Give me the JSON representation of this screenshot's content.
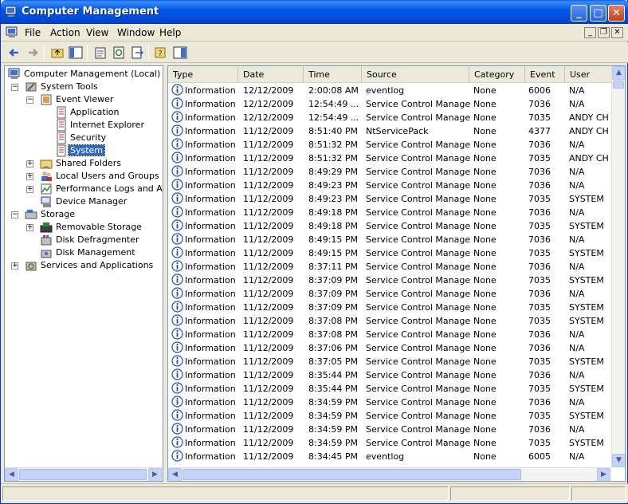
{
  "window": {
    "title": "Computer Management"
  },
  "menu": [
    "File",
    "Action",
    "View",
    "Window",
    "Help"
  ],
  "toolbar": {
    "icons": [
      "back-icon",
      "forward-icon",
      "up-folder-icon",
      "show-hide-tree-icon",
      "properties-icon",
      "refresh-icon",
      "export-list-icon",
      "help-icon",
      "action-pane-icon"
    ]
  },
  "tree": {
    "root": "Computer Management (Local)",
    "items": [
      {
        "label": "System Tools"
      },
      {
        "label": "Event Viewer"
      },
      {
        "label": "Application"
      },
      {
        "label": "Internet Explorer"
      },
      {
        "label": "Security"
      },
      {
        "label": "System"
      },
      {
        "label": "Shared Folders"
      },
      {
        "label": "Local Users and Groups"
      },
      {
        "label": "Performance Logs and Alerts"
      },
      {
        "label": "Device Manager"
      },
      {
        "label": "Storage"
      },
      {
        "label": "Removable Storage"
      },
      {
        "label": "Disk Defragmenter"
      },
      {
        "label": "Disk Management"
      },
      {
        "label": "Services and Applications"
      }
    ]
  },
  "columns": [
    "Type",
    "Date",
    "Time",
    "Source",
    "Category",
    "Event",
    "User"
  ],
  "rows": [
    [
      "Information",
      "12/12/2009",
      "2:00:08 AM",
      "eventlog",
      "None",
      "6006",
      "N/A"
    ],
    [
      "Information",
      "12/12/2009",
      "12:54:49 ...",
      "Service Control Manager",
      "None",
      "7036",
      "N/A"
    ],
    [
      "Information",
      "12/12/2009",
      "12:54:49 ...",
      "Service Control Manager",
      "None",
      "7035",
      "ANDY CHEN"
    ],
    [
      "Information",
      "11/12/2009",
      "8:51:40 PM",
      "NtServicePack",
      "None",
      "4377",
      "ANDY CHEN"
    ],
    [
      "Information",
      "11/12/2009",
      "8:51:32 PM",
      "Service Control Manager",
      "None",
      "7036",
      "N/A"
    ],
    [
      "Information",
      "11/12/2009",
      "8:51:32 PM",
      "Service Control Manager",
      "None",
      "7035",
      "ANDY CHEN"
    ],
    [
      "Information",
      "11/12/2009",
      "8:49:29 PM",
      "Service Control Manager",
      "None",
      "7036",
      "N/A"
    ],
    [
      "Information",
      "11/12/2009",
      "8:49:23 PM",
      "Service Control Manager",
      "None",
      "7036",
      "N/A"
    ],
    [
      "Information",
      "11/12/2009",
      "8:49:23 PM",
      "Service Control Manager",
      "None",
      "7035",
      "SYSTEM"
    ],
    [
      "Information",
      "11/12/2009",
      "8:49:18 PM",
      "Service Control Manager",
      "None",
      "7036",
      "N/A"
    ],
    [
      "Information",
      "11/12/2009",
      "8:49:18 PM",
      "Service Control Manager",
      "None",
      "7035",
      "SYSTEM"
    ],
    [
      "Information",
      "11/12/2009",
      "8:49:15 PM",
      "Service Control Manager",
      "None",
      "7036",
      "N/A"
    ],
    [
      "Information",
      "11/12/2009",
      "8:49:15 PM",
      "Service Control Manager",
      "None",
      "7035",
      "SYSTEM"
    ],
    [
      "Information",
      "11/12/2009",
      "8:37:11 PM",
      "Service Control Manager",
      "None",
      "7036",
      "N/A"
    ],
    [
      "Information",
      "11/12/2009",
      "8:37:09 PM",
      "Service Control Manager",
      "None",
      "7035",
      "SYSTEM"
    ],
    [
      "Information",
      "11/12/2009",
      "8:37:09 PM",
      "Service Control Manager",
      "None",
      "7036",
      "N/A"
    ],
    [
      "Information",
      "11/12/2009",
      "8:37:09 PM",
      "Service Control Manager",
      "None",
      "7035",
      "SYSTEM"
    ],
    [
      "Information",
      "11/12/2009",
      "8:37:08 PM",
      "Service Control Manager",
      "None",
      "7035",
      "SYSTEM"
    ],
    [
      "Information",
      "11/12/2009",
      "8:37:08 PM",
      "Service Control Manager",
      "None",
      "7036",
      "N/A"
    ],
    [
      "Information",
      "11/12/2009",
      "8:37:06 PM",
      "Service Control Manager",
      "None",
      "7036",
      "N/A"
    ],
    [
      "Information",
      "11/12/2009",
      "8:37:05 PM",
      "Service Control Manager",
      "None",
      "7035",
      "SYSTEM"
    ],
    [
      "Information",
      "11/12/2009",
      "8:35:44 PM",
      "Service Control Manager",
      "None",
      "7036",
      "N/A"
    ],
    [
      "Information",
      "11/12/2009",
      "8:35:44 PM",
      "Service Control Manager",
      "None",
      "7035",
      "SYSTEM"
    ],
    [
      "Information",
      "11/12/2009",
      "8:34:59 PM",
      "Service Control Manager",
      "None",
      "7036",
      "N/A"
    ],
    [
      "Information",
      "11/12/2009",
      "8:34:59 PM",
      "Service Control Manager",
      "None",
      "7035",
      "SYSTEM"
    ],
    [
      "Information",
      "11/12/2009",
      "8:34:59 PM",
      "Service Control Manager",
      "None",
      "7036",
      "N/A"
    ],
    [
      "Information",
      "11/12/2009",
      "8:34:59 PM",
      "Service Control Manager",
      "None",
      "7035",
      "SYSTEM"
    ],
    [
      "Information",
      "11/12/2009",
      "8:34:45 PM",
      "eventlog",
      "None",
      "6005",
      "N/A"
    ]
  ],
  "colors": {
    "title_bar": "#0054e3",
    "selection": "#316ac5",
    "info_icon": "#1f4fb5"
  }
}
